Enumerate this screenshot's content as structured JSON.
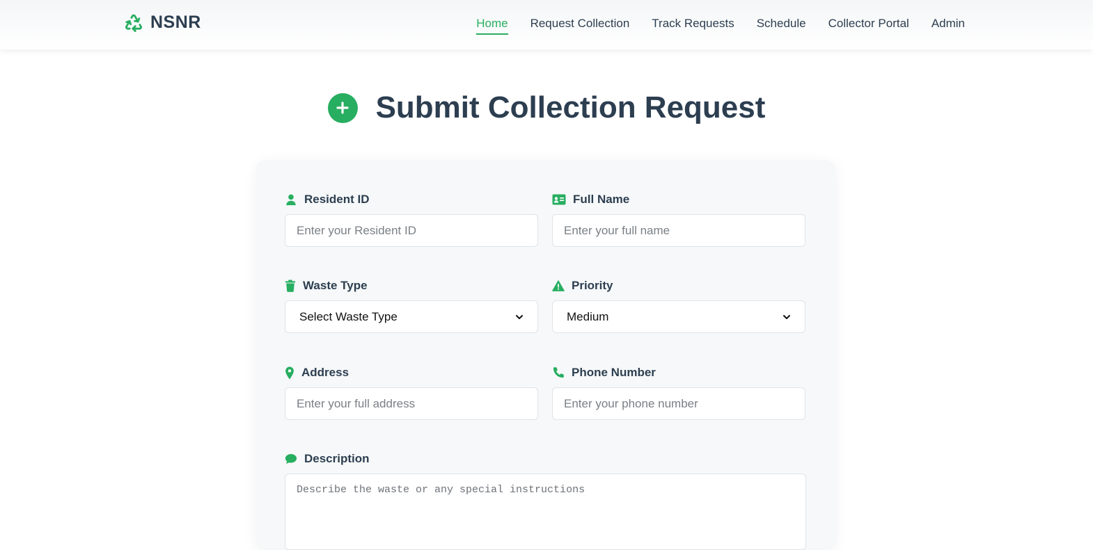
{
  "brand": {
    "name": "NSNR",
    "icon": "recycle-icon"
  },
  "nav": [
    {
      "label": "Home",
      "active": true
    },
    {
      "label": "Request Collection",
      "active": false
    },
    {
      "label": "Track Requests",
      "active": false
    },
    {
      "label": "Schedule",
      "active": false
    },
    {
      "label": "Collector Portal",
      "active": false
    },
    {
      "label": "Admin",
      "active": false
    }
  ],
  "page": {
    "title": "Submit Collection Request",
    "title_icon": "plus-circle-icon"
  },
  "form": {
    "resident_id": {
      "label": "Resident ID",
      "placeholder": "Enter your Resident ID",
      "icon": "user-icon"
    },
    "full_name": {
      "label": "Full Name",
      "placeholder": "Enter your full name",
      "icon": "id-card-icon"
    },
    "waste_type": {
      "label": "Waste Type",
      "value": "Select Waste Type",
      "icon": "trash-icon"
    },
    "priority": {
      "label": "Priority",
      "value": "Medium",
      "icon": "warning-icon"
    },
    "address": {
      "label": "Address",
      "placeholder": "Enter your full address",
      "icon": "map-pin-icon"
    },
    "phone": {
      "label": "Phone Number",
      "placeholder": "Enter your phone number",
      "icon": "phone-icon"
    },
    "description": {
      "label": "Description",
      "placeholder": "Describe the waste or any special instructions",
      "icon": "comment-icon"
    }
  },
  "colors": {
    "accent": "#27ae60",
    "text": "#2c3e50",
    "card_bg": "#f6f8f9"
  }
}
